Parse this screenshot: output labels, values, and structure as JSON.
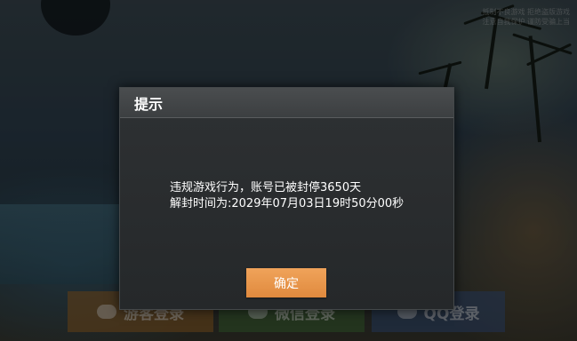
{
  "dialog": {
    "title": "提示",
    "message_line1": "违规游戏行为，账号已被封停3650天",
    "message_line2": "解封时间为:2029年07月03日19时50分00秒",
    "confirm_label": "确定"
  },
  "login": {
    "guest_label": "游客登录",
    "wechat_label": "微信登录",
    "qq_label": "QQ登录"
  },
  "corner_notice": {
    "line1": "抵制不良游戏  拒绝盗版游戏",
    "line2": "注意自我保护  谨防受骗上当"
  },
  "colors": {
    "confirm_button": "#e8964a",
    "dialog_background": "#2a2d2f",
    "dialog_header": "#424547"
  }
}
